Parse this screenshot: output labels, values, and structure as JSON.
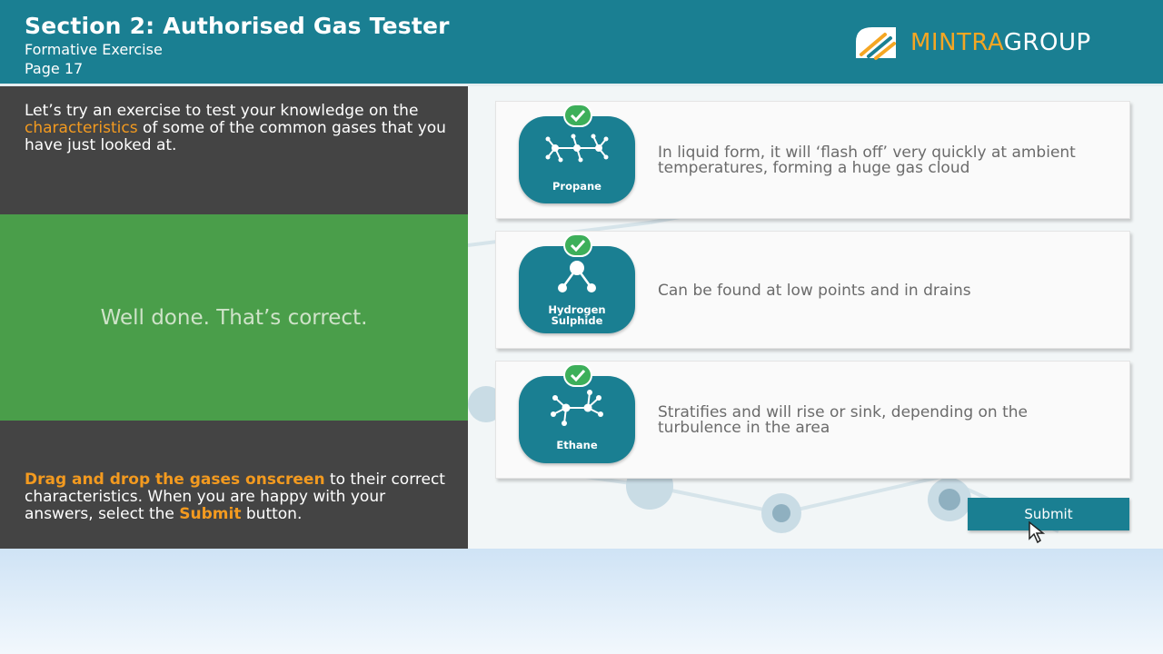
{
  "header": {
    "title": "Section 2: Authorised Gas Tester",
    "subtitle": "Formative Exercise",
    "page": "Page 17",
    "logo": {
      "brand_accent": "MINTRA",
      "brand_rest": "GROUP"
    }
  },
  "intro": {
    "part1": "Let’s try an exercise to test your knowledge on the ",
    "highlight": "characteristics",
    "part2": " of some of the common gases that you have just looked at."
  },
  "feedback": {
    "message": "Well done. That’s correct."
  },
  "instructions": {
    "highlight1": "Drag and drop the gases onscreen",
    "part1": " to their correct characteristics. When you are happy with your answers, select the ",
    "highlight2": "Submit",
    "part2": " button."
  },
  "cards": [
    {
      "gas_label": "Propane",
      "gas_icon": "propane-molecule-icon",
      "text": "In liquid form, it will ‘flash off’ very quickly at ambient temperatures, forming a huge gas cloud"
    },
    {
      "gas_label_line1": "Hydrogen",
      "gas_label_line2": "Sulphide",
      "gas_icon": "hydrogen-sulphide-molecule-icon",
      "text": "Can be found at low points and in drains"
    },
    {
      "gas_label": "Ethane",
      "gas_icon": "ethane-molecule-icon",
      "text": "Stratifies and will rise or sink, depending on the turbulence in the area"
    }
  ],
  "submit": {
    "label": "Submit"
  },
  "colors": {
    "header": "#1a7f92",
    "dark_panel": "#444444",
    "feedback_green": "#4a9e4a",
    "highlight_orange": "#f39a1f",
    "check_green": "#3daf5a"
  }
}
